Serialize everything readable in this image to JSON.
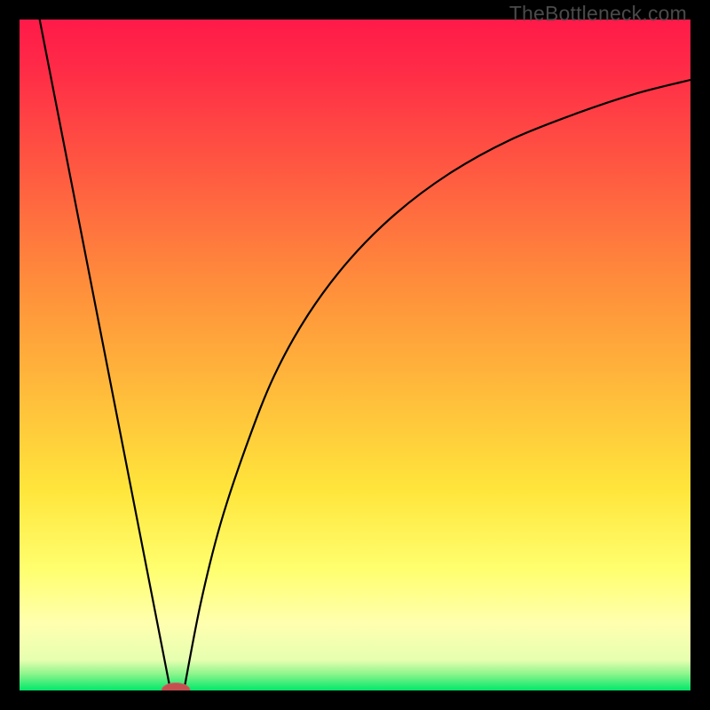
{
  "watermark": "TheBottleneck.com",
  "colors": {
    "frame": "#000000",
    "top": "#ff1a49",
    "mid_upper": "#ff8f3b",
    "mid_lower": "#ffe53b",
    "pale": "#ffff9b",
    "green": "#00e86a",
    "line": "#000000",
    "marker_fill": "#c4504f",
    "marker_stroke": "#cc5f5e"
  },
  "chart_data": {
    "type": "line",
    "title": "",
    "xlabel": "",
    "ylabel": "",
    "xlim": [
      0,
      100
    ],
    "ylim": [
      0,
      100
    ],
    "grid": false,
    "legend": false,
    "gradient_stops": [
      {
        "pos": 0.0,
        "color": "#ff1a49"
      },
      {
        "pos": 0.07,
        "color": "#ff2a47"
      },
      {
        "pos": 0.4,
        "color": "#ff8f3b"
      },
      {
        "pos": 0.7,
        "color": "#ffe53b"
      },
      {
        "pos": 0.82,
        "color": "#ffff6f"
      },
      {
        "pos": 0.9,
        "color": "#ffffaf"
      },
      {
        "pos": 0.955,
        "color": "#e6ffb0"
      },
      {
        "pos": 0.975,
        "color": "#8ef58c"
      },
      {
        "pos": 1.0,
        "color": "#00e86a"
      }
    ],
    "series": [
      {
        "name": "left-branch",
        "x": [
          3,
          22.5
        ],
        "y": [
          100,
          0
        ]
      },
      {
        "name": "right-branch",
        "x": [
          24.5,
          27,
          30,
          34,
          38,
          43,
          49,
          56,
          64,
          73,
          83,
          92,
          100
        ],
        "y": [
          0,
          13,
          25,
          37,
          47,
          56,
          64,
          71,
          77,
          82,
          86,
          89,
          91
        ]
      }
    ],
    "marker": {
      "x": 23.3,
      "y": 0,
      "rx": 2.1,
      "ry": 1.1
    }
  }
}
